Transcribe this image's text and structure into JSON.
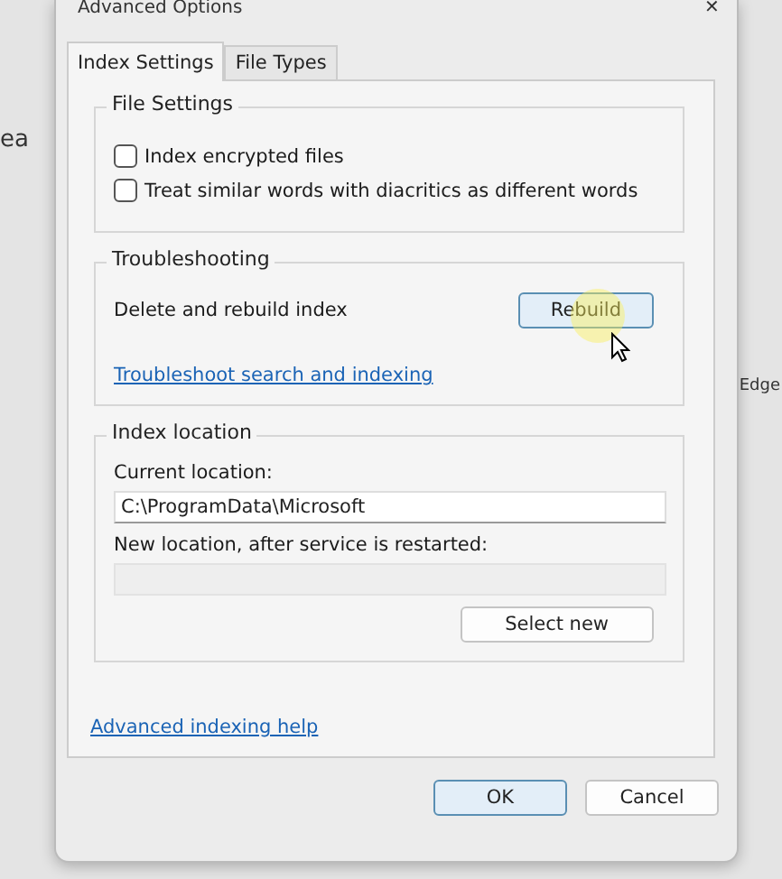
{
  "background": {
    "left_text": "ea",
    "right_text": "Edge"
  },
  "window": {
    "title": "Advanced Options",
    "close": "✕"
  },
  "tabs": [
    {
      "label": "Index Settings",
      "selected": true
    },
    {
      "label": "File Types",
      "selected": false
    }
  ],
  "file_settings": {
    "title": "File Settings",
    "options": [
      {
        "label": "Index encrypted files",
        "checked": false
      },
      {
        "label": "Treat similar words with diacritics as different words",
        "checked": false
      }
    ]
  },
  "troubleshooting": {
    "title": "Troubleshooting",
    "text": "Delete and rebuild index",
    "button": "Rebuild",
    "link": "Troubleshoot search and indexing"
  },
  "index_location": {
    "title": "Index location",
    "current_label": "Current location:",
    "current_value": "C:\\ProgramData\\Microsoft",
    "new_label": "New location, after service is restarted:",
    "new_disabled": true,
    "button": "Select new"
  },
  "help_link": "Advanced indexing help",
  "buttons": [
    {
      "label": "OK",
      "default": true
    },
    {
      "label": "Cancel",
      "default": false
    }
  ]
}
